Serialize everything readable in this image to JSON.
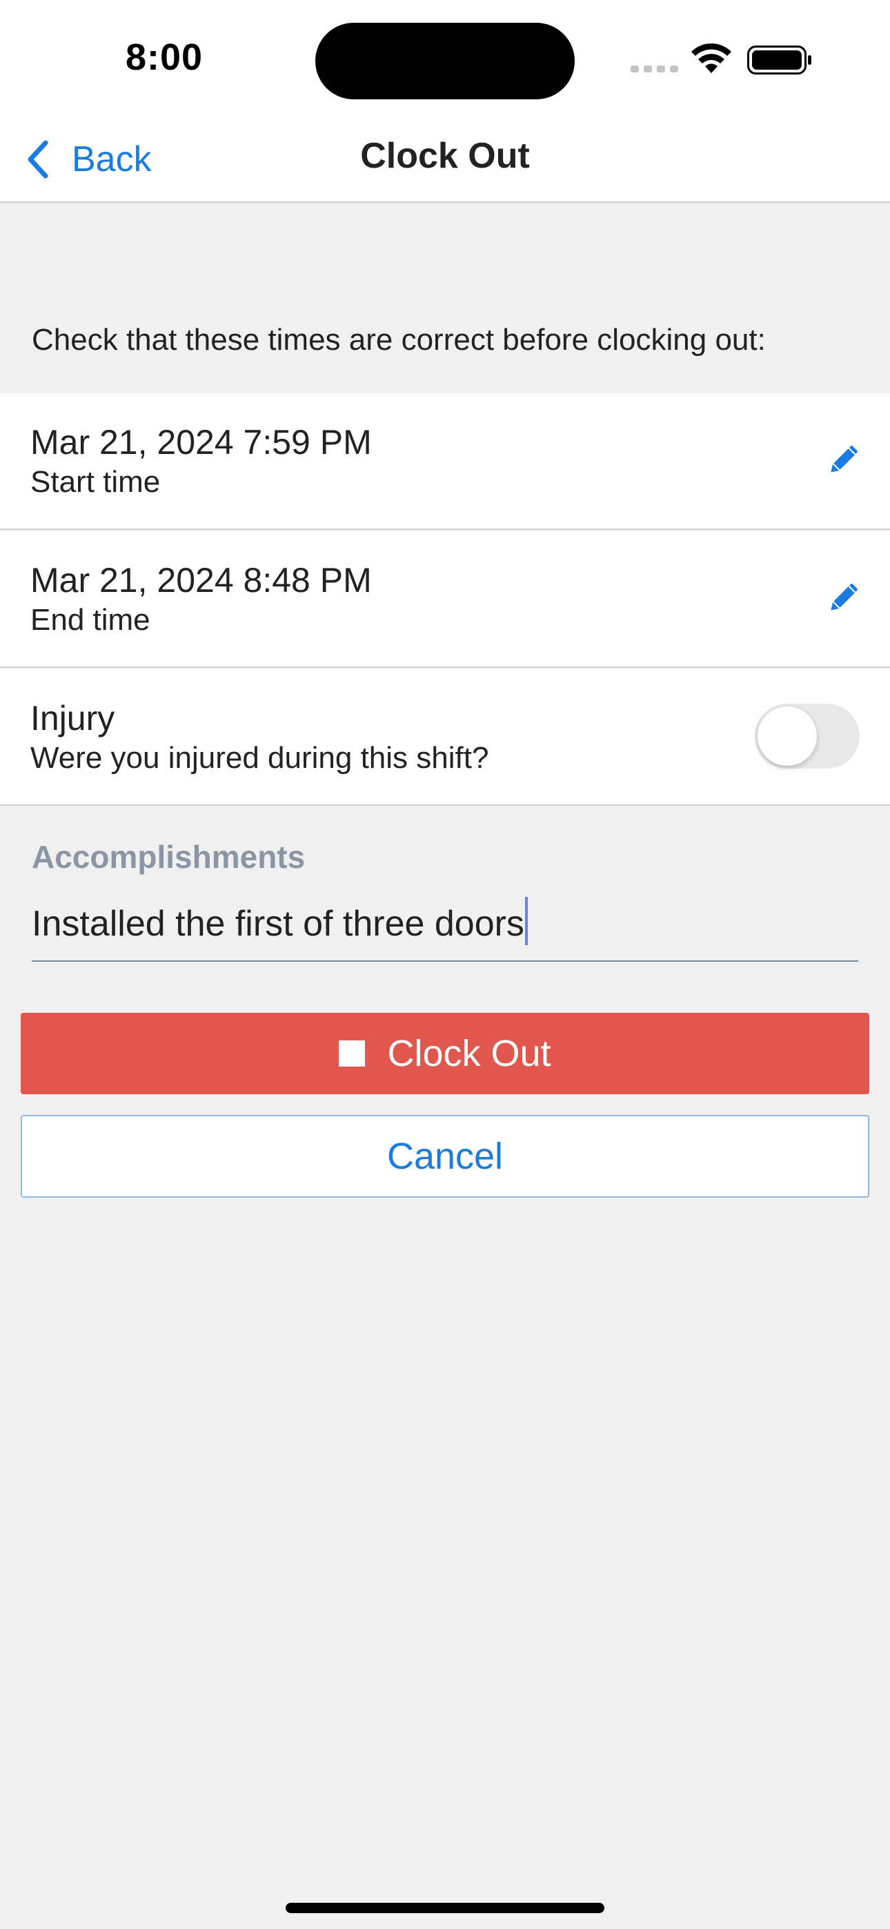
{
  "status_bar": {
    "time": "8:00"
  },
  "nav": {
    "back_label": "Back",
    "title": "Clock Out"
  },
  "instructions": "Check that these times are correct before clocking out:",
  "rows": [
    {
      "title": "Mar 21, 2024 7:59 PM",
      "subtitle": "Start time",
      "action_icon": "pencil-icon"
    },
    {
      "title": "Mar 21, 2024 8:48 PM",
      "subtitle": "End time",
      "action_icon": "pencil-icon"
    },
    {
      "title": "Injury",
      "subtitle": "Were you injured during this shift?",
      "toggle_on": false
    }
  ],
  "accomplishments": {
    "label": "Accomplishments",
    "value": "Installed the first of three doors"
  },
  "buttons": {
    "clock_out_label": "Clock Out",
    "cancel_label": "Cancel"
  },
  "colors": {
    "accent": "#1a7be0",
    "danger": "#e2574d",
    "background": "#f0f0f0",
    "label_muted": "#8a96a3"
  }
}
